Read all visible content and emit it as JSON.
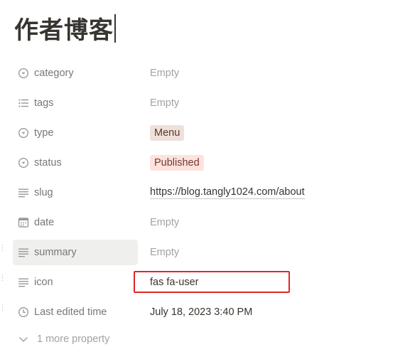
{
  "page": {
    "title": "作者博客"
  },
  "properties": [
    {
      "name": "category",
      "icon": "select-circle-icon",
      "value": "Empty",
      "value_type": "empty"
    },
    {
      "name": "tags",
      "icon": "list-icon",
      "value": "Empty",
      "value_type": "empty"
    },
    {
      "name": "type",
      "icon": "select-circle-icon",
      "value": "Menu",
      "value_type": "tag",
      "tag_color": "#eee0da"
    },
    {
      "name": "status",
      "icon": "select-circle-icon",
      "value": "Published",
      "value_type": "tag",
      "tag_color": "#ffe2dd"
    },
    {
      "name": "slug",
      "icon": "text-lines-icon",
      "value": "https://blog.tangly1024.com/about",
      "value_type": "url"
    },
    {
      "name": "date",
      "icon": "calendar-icon",
      "value": "Empty",
      "value_type": "empty"
    },
    {
      "name": "summary",
      "icon": "text-lines-icon",
      "value": "Empty",
      "value_type": "empty",
      "hovered": true
    },
    {
      "name": "icon",
      "icon": "text-lines-icon",
      "value": "fas fa-user",
      "value_type": "text",
      "highlighted": true
    },
    {
      "name": "Last edited time",
      "icon": "clock-icon",
      "value": "July 18, 2023 3:40 PM",
      "value_type": "text"
    }
  ],
  "more_properties": {
    "label": "1 more property",
    "icon": "chevron-down-icon"
  },
  "colors": {
    "text": "#37352f",
    "muted": "#787774",
    "placeholder": "#a3a29e",
    "highlight_border": "#e0262a"
  }
}
